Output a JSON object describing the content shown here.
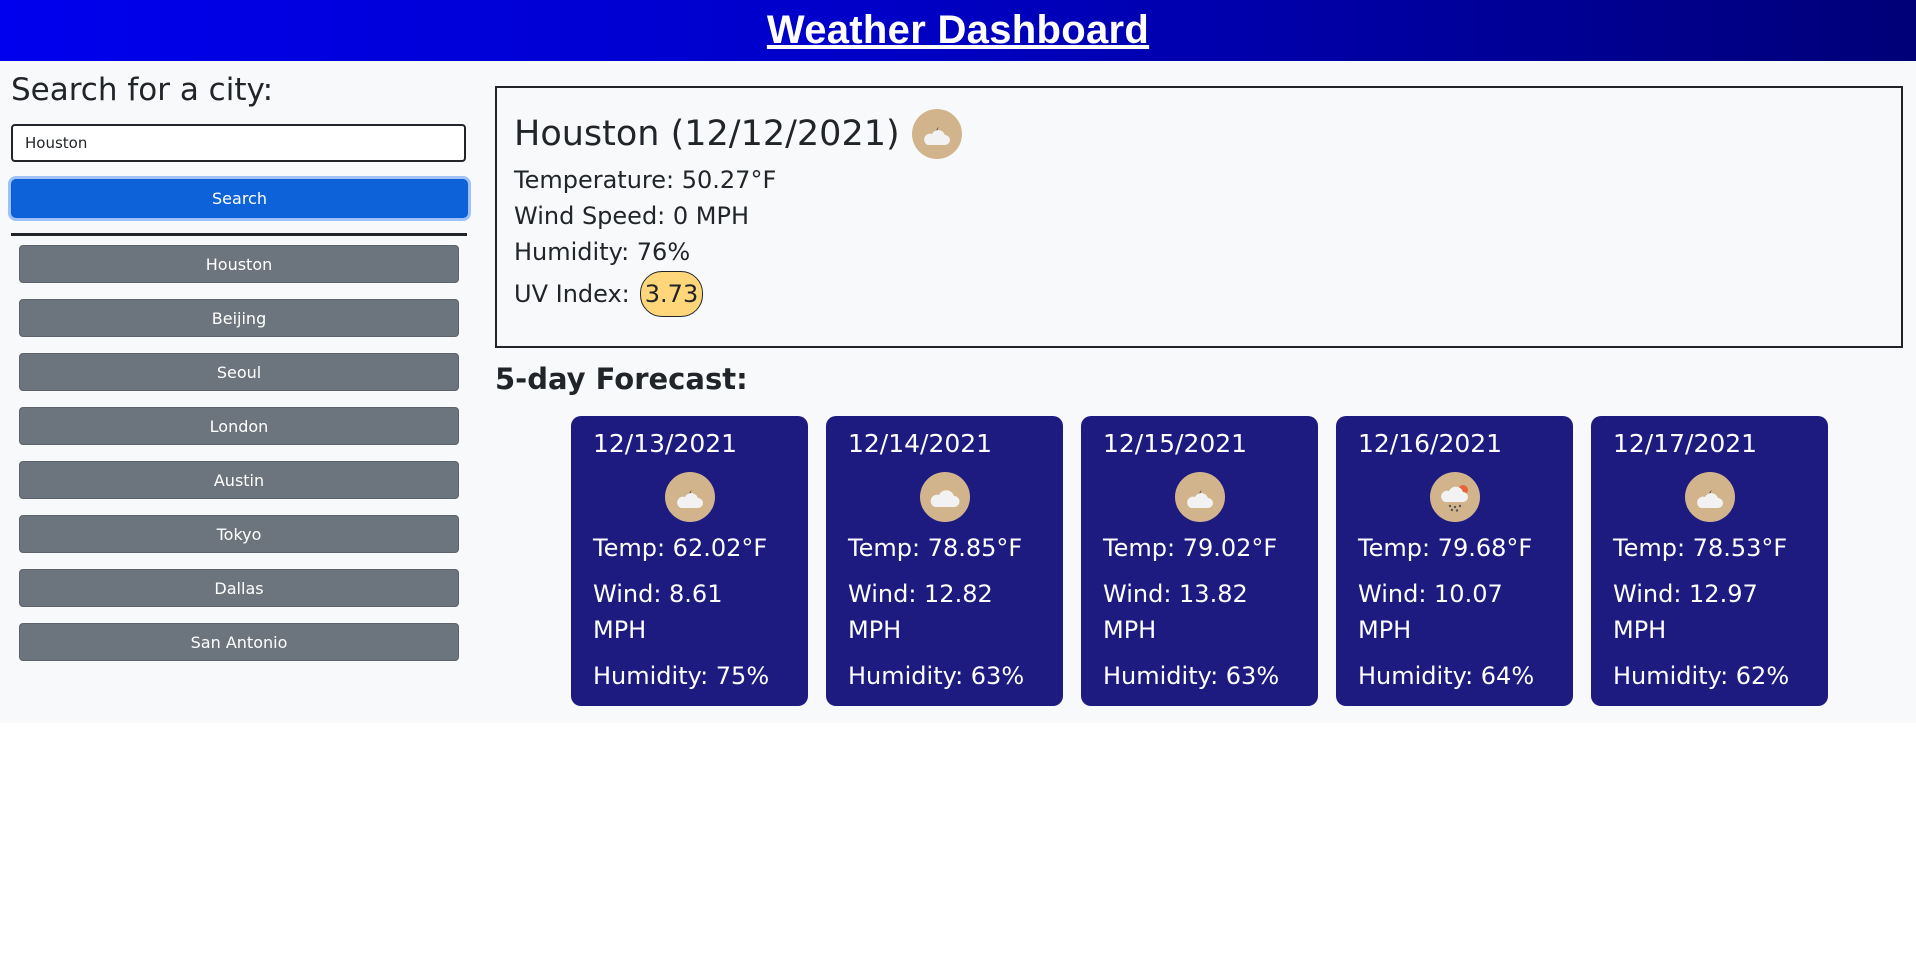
{
  "header": {
    "title": "Weather Dashboard"
  },
  "sidebar": {
    "heading": "Search for a city:",
    "search_value": "Houston",
    "search_button_label": "Search",
    "history": [
      "Houston",
      "Beijing",
      "Seoul",
      "London",
      "Austin",
      "Tokyo",
      "Dallas",
      "San Antonio"
    ]
  },
  "current": {
    "title": "Houston (12/12/2021)",
    "icon": "cloudy-night-icon",
    "temperature": "Temperature: 50.27°F",
    "wind": "Wind Speed: 0 MPH",
    "humidity": "Humidity: 76%",
    "uv_label": "UV Index:",
    "uv_value": "3.73",
    "uv_color": "#ffd77a"
  },
  "forecast": {
    "heading": "5-day Forecast:",
    "days": [
      {
        "date": "12/13/2021",
        "icon": "cloudy-night-icon",
        "temp": "Temp: 62.02°F",
        "wind": "Wind: 8.61 MPH",
        "humidity": "Humidity: 75%"
      },
      {
        "date": "12/14/2021",
        "icon": "cloud-icon",
        "temp": "Temp: 78.85°F",
        "wind": "Wind: 12.82 MPH",
        "humidity": "Humidity: 63%"
      },
      {
        "date": "12/15/2021",
        "icon": "cloudy-night-icon",
        "temp": "Temp: 79.02°F",
        "wind": "Wind: 13.82 MPH",
        "humidity": "Humidity: 63%"
      },
      {
        "date": "12/16/2021",
        "icon": "rain-icon",
        "temp": "Temp: 79.68°F",
        "wind": "Wind: 10.07 MPH",
        "humidity": "Humidity: 64%"
      },
      {
        "date": "12/17/2021",
        "icon": "cloudy-night-icon",
        "temp": "Temp: 78.53°F",
        "wind": "Wind: 12.97 MPH",
        "humidity": "Humidity: 62%"
      }
    ]
  },
  "colors": {
    "header_start": "#0000ee",
    "header_end": "#000078",
    "primary_button": "#0d62d9",
    "history_button": "#6c757d",
    "forecast_card": "#1d1a80",
    "icon_background": "#d2b48c"
  }
}
